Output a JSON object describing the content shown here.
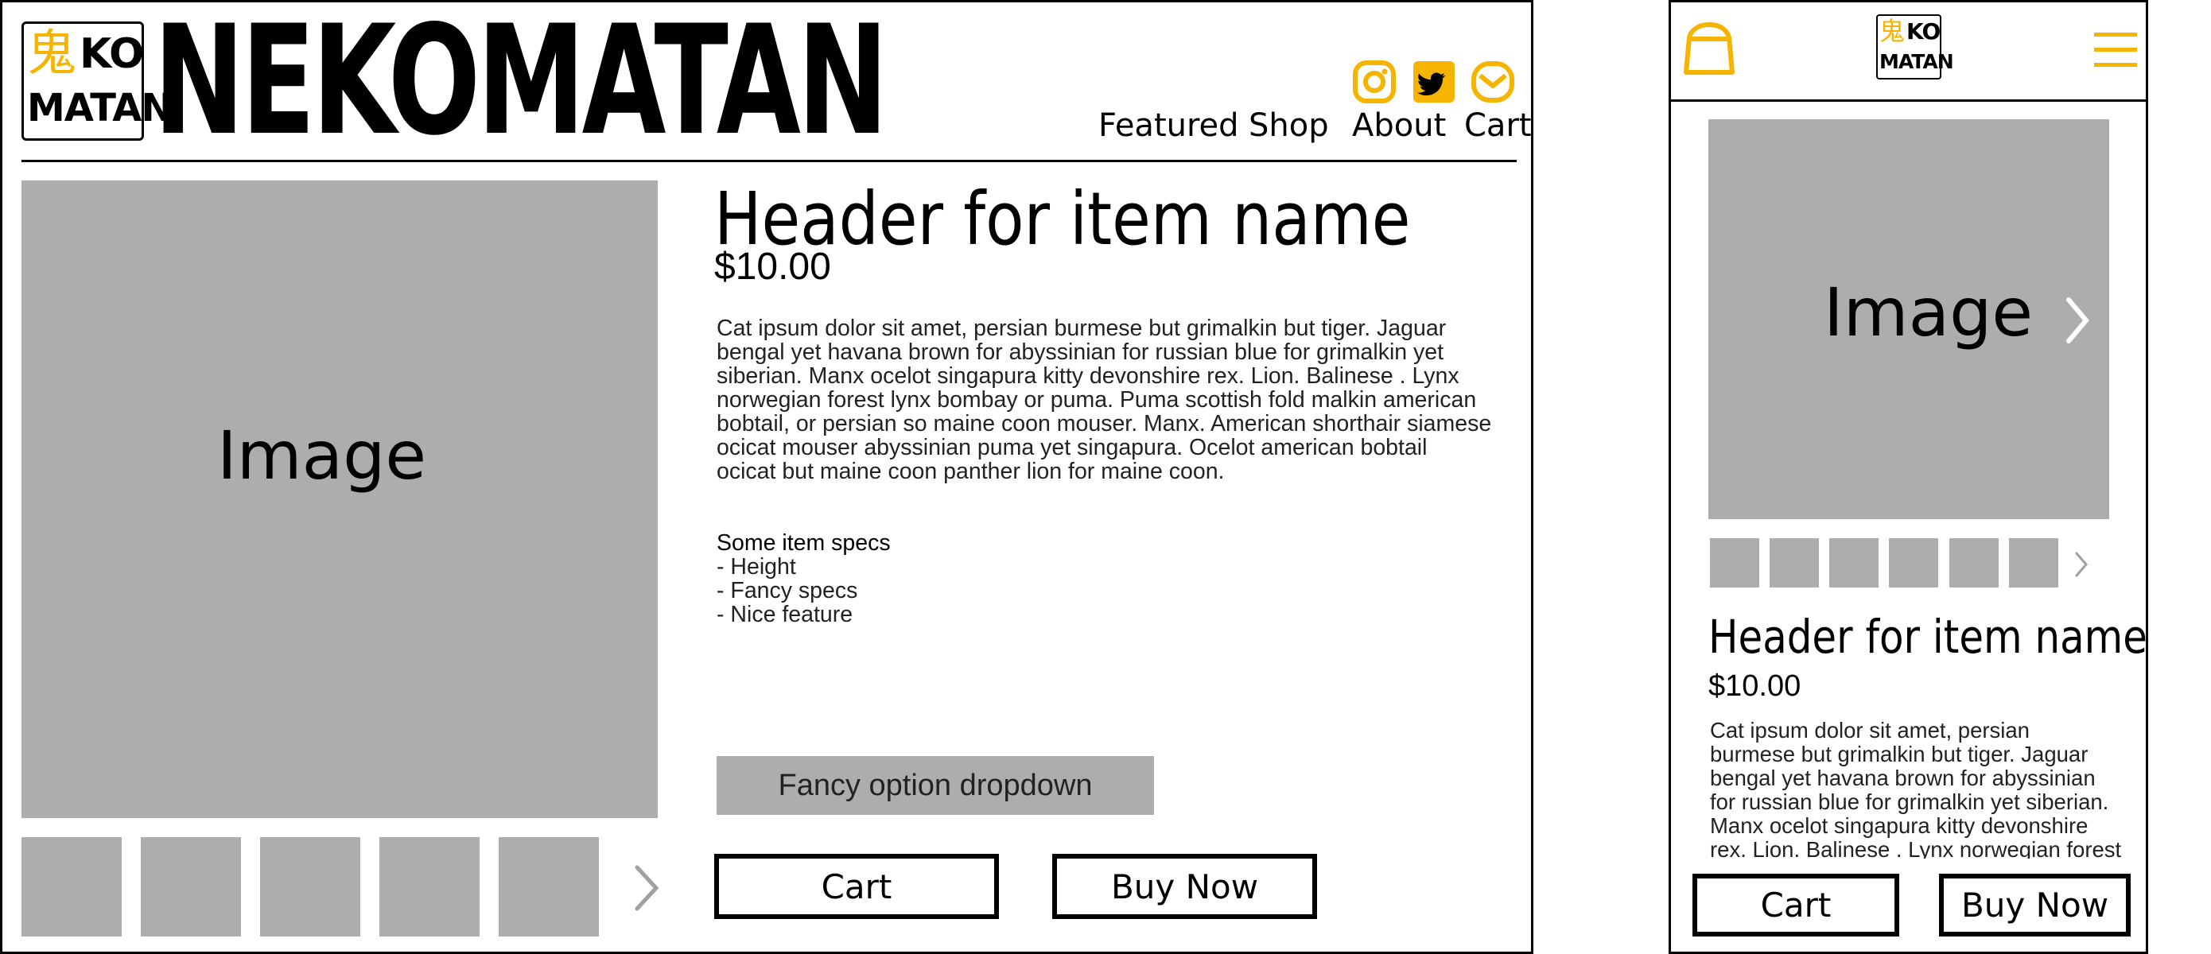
{
  "desktop": {
    "logo": {
      "line1": "KO",
      "line2": "MATAN",
      "mark": "鬼"
    },
    "brand": "NEKOMATAN",
    "nav": [
      "Featured",
      "Shop",
      "About",
      "Cart"
    ],
    "social": [
      "instagram-icon",
      "twitter-icon",
      "mail-icon"
    ],
    "image_label": "Image",
    "item": {
      "title": "Header for item name",
      "price": "$10.00",
      "description_lines": [
        "Cat ipsum dolor sit amet, persian burmese but grimalkin but tiger. Jaguar",
        "bengal yet havana brown for abyssinian for russian blue for grimalkin yet",
        "siberian. Manx ocelot singapura kitty devonshire rex. Lion. Balinese . Lynx",
        "norwegian forest lynx bombay or puma. Puma scottish fold malkin american",
        "bobtail, or persian so maine coon mouser. Manx. American shorthair siamese",
        "ocicat mouser abyssinian puma yet singapura. Ocelot american bobtail",
        "ocicat but maine coon panther lion for maine coon."
      ],
      "specs_title": "Some item specs",
      "specs": [
        "- Height",
        "- Fancy specs",
        "- Nice feature"
      ],
      "dropdown": "Fancy option dropdown",
      "cart_button": "Cart",
      "buy_button": "Buy Now"
    }
  },
  "mobile": {
    "logo": {
      "line1": "KO",
      "line2": "MATAN",
      "mark": "鬼"
    },
    "left_icon": "bag-icon",
    "right_icon": "hamburger-menu-icon",
    "image_label": "Image",
    "item": {
      "title": "Header for item name",
      "price": "$10.00",
      "description_lines": [
        "Cat ipsum dolor sit amet, persian",
        "burmese but grimalkin but tiger. Jaguar",
        "bengal yet havana brown for abyssinian",
        "for russian blue for grimalkin yet siberian.",
        "Manx ocelot singapura kitty devonshire",
        "rex. Lion. Balinese . Lynx norwegian forest"
      ],
      "cart_button": "Cart",
      "buy_button": "Buy Now"
    }
  },
  "colors": {
    "accent": "#f4b400",
    "placeholder": "#adadad",
    "ink": "#000000"
  }
}
